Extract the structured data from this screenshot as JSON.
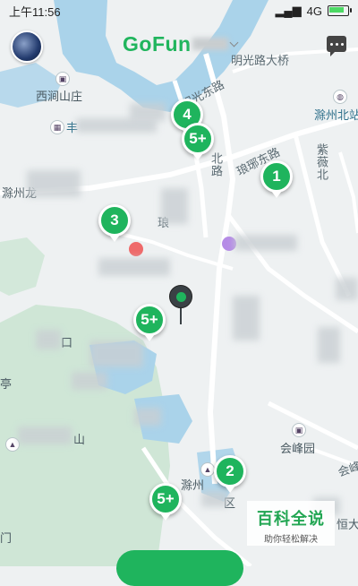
{
  "status_bar": {
    "time": "上午11:56",
    "network": "4G",
    "battery_level": 0.85
  },
  "header": {
    "logo_text": "GoFun"
  },
  "map_labels": {
    "mingguang_bridge": "明光路大桥",
    "mingguang_east_road": "明光东路",
    "xijian_villa": "西涧山庄",
    "chuzhou_north_station": "滁州北站",
    "langya_east_road": "琅琊东路",
    "chuzhou_long": "滁州龙",
    "zijin": "紫薇北",
    "bei_road": "北路",
    "lang": "琅",
    "kou": "口",
    "ting": "亭",
    "shan": "山",
    "huifeng_garden": "会峰园",
    "huifeng_short": "会峰",
    "chuzhou_qu": "滁州",
    "qu": "区",
    "heng": "恒大",
    "men": "门",
    "zhu": "丰"
  },
  "markers": [
    {
      "label": "4"
    },
    {
      "label": "5+"
    },
    {
      "label": "1"
    },
    {
      "label": "3"
    },
    {
      "label": "5+"
    },
    {
      "label": "2"
    },
    {
      "label": "5+"
    }
  ],
  "watermark": {
    "title": "百科全说",
    "subtitle": "助你轻松解决"
  },
  "colors": {
    "brand": "#1fb45d",
    "water": "#aad3ea",
    "park": "#cfe6d6",
    "road": "#ffffff"
  }
}
